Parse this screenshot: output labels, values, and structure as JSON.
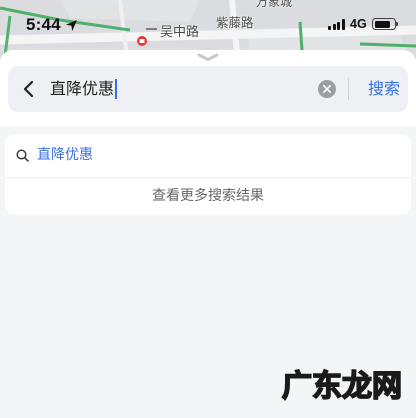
{
  "status_bar": {
    "time": "5:44",
    "network": "4G",
    "signal_bars": 4,
    "battery_level": 0.8,
    "location_icon": "location-arrow-icon"
  },
  "map": {
    "road_label_1": "吴中路",
    "road_label_2": "紫藤路",
    "poi_label": "万象城",
    "station_icon": "metro-icon"
  },
  "search_bar": {
    "back_icon": "chevron-left-icon",
    "query": "直降优惠",
    "clear_icon": "clear-icon",
    "submit_label": "搜索"
  },
  "suggestions": [
    {
      "icon": "search-icon",
      "text": "直降优惠"
    }
  ],
  "more_results_label": "查看更多搜索结果",
  "watermark": "广东龙网",
  "colors": {
    "accent": "#3370e8",
    "suggestion_text": "#3a6fdc",
    "sheet_background": "#f4f5f7",
    "search_bar_background": "#eef0f4"
  }
}
